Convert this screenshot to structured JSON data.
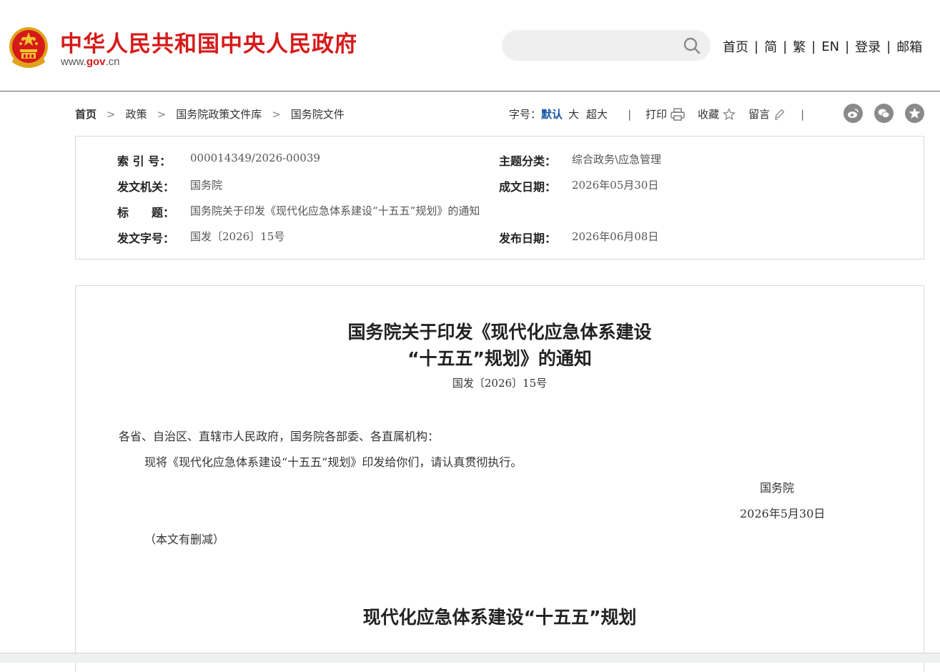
{
  "header": {
    "site_title": "中华人民共和国中央人民政府",
    "domain_prefix": "www.",
    "domain_brand": "gov",
    "domain_suffix": ".cn",
    "search": {
      "placeholder": "",
      "value": ""
    },
    "nav": [
      "首页",
      "简",
      "繁",
      "EN",
      "登录",
      "邮箱"
    ],
    "brand_color": "#d61a1a"
  },
  "breadcrumb": [
    "首页",
    "政策",
    "国务院政策文件库",
    "国务院文件"
  ],
  "tools": {
    "font_size_label": "字号：",
    "font_sizes": [
      "默认",
      "大",
      "超大"
    ],
    "print": "打印",
    "favorite": "收藏",
    "comment": "留言",
    "share_icons": [
      "weibo-icon",
      "wechat-icon",
      "qzone-icon"
    ],
    "active_color": "#1a56a7"
  },
  "meta": {
    "index_label": "索 引 号：",
    "index_value": "000014349/2026-00039",
    "topic_label": "主题分类：",
    "topic_value": "综合政务\\应急管理",
    "issuer_label": "发文机关：",
    "issuer_value": "国务院",
    "written_label": "成文日期：",
    "written_value": "2026年05月30日",
    "title_label": "标　　题：",
    "title_value": "国务院关于印发《现代化应急体系建设“十五五”规划》的通知",
    "docno_label": "发文字号：",
    "docno_value": "国发〔2026〕15号",
    "published_label": "发布日期：",
    "published_value": "2026年06月08日"
  },
  "article": {
    "title_line1": "国务院关于印发《现代化应急体系建设",
    "title_line2": "“十五五”规划》的通知",
    "doc_number": "国发〔2026〕15号",
    "salutation": "各省、自治区、直辖市人民政府，国务院各部委、各直属机构：",
    "body": "现将《现代化应急体系建设“十五五”规划》印发给你们，请认真贯彻执行。",
    "signatory": "国务院",
    "date": "2026年5月30日",
    "note": "（本文有删减）",
    "plan_title": "现代化应急体系建设“十五五”规划"
  }
}
